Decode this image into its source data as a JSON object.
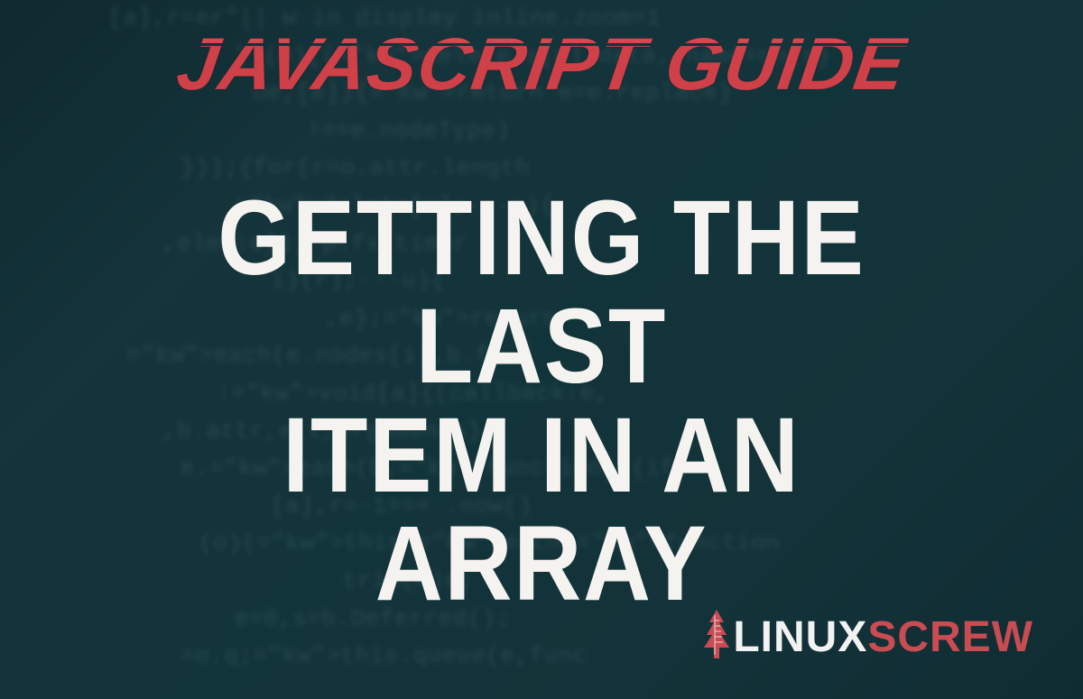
{
  "category_label": "JAVASCRIPT GUIDE",
  "title_line1": "GETTING THE LAST",
  "title_line2": "ITEM IN AN ARRAY",
  "brand": {
    "part1": "LINUX",
    "part2": "SCREW"
  },
  "colors": {
    "accent_red": "#d04048",
    "text_white": "#f5f3ef",
    "bg_teal": "#1a3a42"
  },
  "bg_code_lines": [
    "[a],r=er\"|| w in display inline.zoom=1",
    "})(n)[(delete s[u].data, name=nn(s)",
    "ue,[e]){return e=e.replace}",
    "!==e.nodeType)",
    "}));{for(r=o.attr.length",
    "delete[u];---u){",
    ",elem:e}); p.fx.timer",
    "i)(r);---u){",
    ",e};return",
    "each(e.nodes[i],b.fn.f",
    ":void[a]{(callback:e,",
    ",b.attr,e,t,arguments}",
    "e.each(b,function(){if",
    "[a],r=-1=== .now()",
    "(o)(this.each(function",
    "trim(A)e;",
    "e=0,s=b.Deferred();",
    "=o.q;this.queue(e,func"
  ]
}
